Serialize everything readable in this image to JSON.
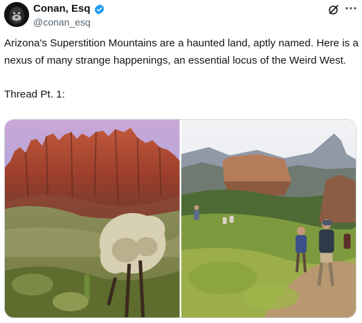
{
  "tweet": {
    "author": {
      "display_name": "Conan, Esq",
      "handle": "@conan_esq",
      "verified": true,
      "avatar_icon": "gorilla-avatar"
    },
    "text": "Arizona's Superstition Mountains are a haunted land, aptly named. Here is a nexus of many strange happenings, an essential locus of the Weird West.\n\nThread Pt. 1:",
    "actions": {
      "grok_icon": "grok-icon",
      "more_icon": "more-icon"
    },
    "media": [
      {
        "icon": "photo-mountains-cholla",
        "colors": {
          "sky": "#b7a6d9",
          "rock": "#a4452f",
          "cactus": "#c9c2a6"
        }
      },
      {
        "icon": "photo-hikers-trail",
        "colors": {
          "sky": "#e6eaf0",
          "rock": "#b57c5a",
          "brush": "#8aa33c"
        }
      }
    ]
  },
  "theme": {
    "accent": "#1d9bf0",
    "text": "#0f1419",
    "secondary": "#536471"
  }
}
